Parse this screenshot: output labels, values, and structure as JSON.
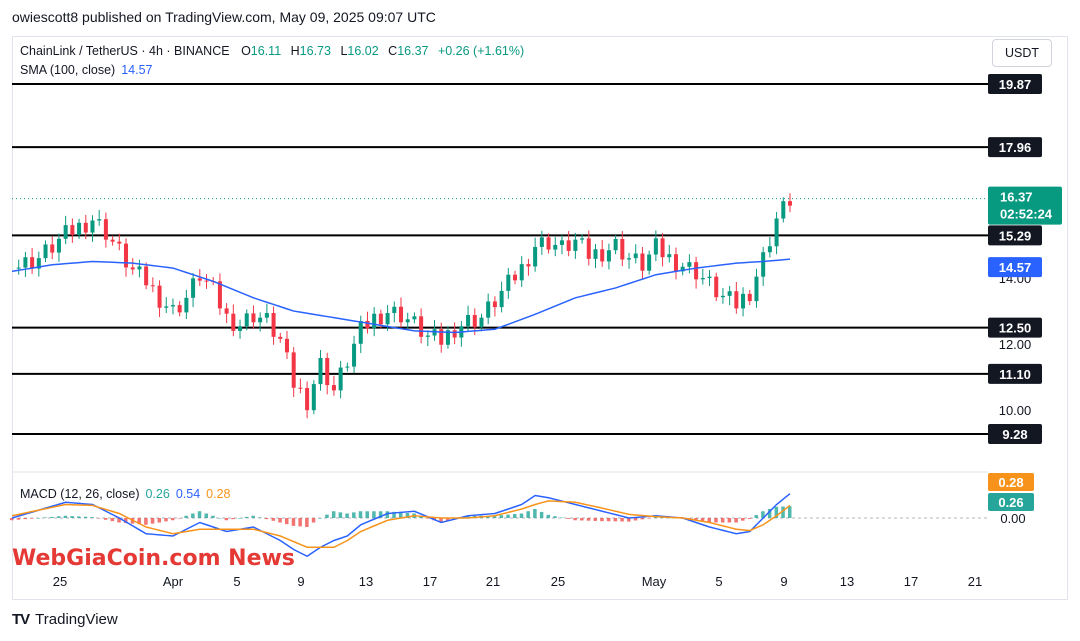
{
  "publisher_line": "owiescott8 published on TradingView.com, May 09, 2025 09:07 UTC",
  "header": {
    "symbol": "ChainLink / TetherUS · 4h · BINANCE",
    "open_key": "O",
    "open": "16.11",
    "high_key": "H",
    "high": "16.73",
    "low_key": "L",
    "low": "16.02",
    "close_key": "C",
    "close": "16.37",
    "change": "+0.26 (+1.61%)"
  },
  "sma": {
    "label": "SMA (100, close)",
    "value": "14.57"
  },
  "macd": {
    "label": "MACD (12, 26, close)",
    "hist": "0.26",
    "macd": "0.54",
    "signal": "0.28"
  },
  "currency_button": "USDT",
  "watermark": "WebGiaCoin.com News",
  "footer_brand": "TradingView",
  "footer_logo": "TV",
  "colors": {
    "up": "#089981",
    "down": "#f23645",
    "sma": "#2962ff",
    "signal": "#f7931a",
    "level": "#000000"
  },
  "chart_data": {
    "type": "candlestick",
    "symbol": "LINK/USDT",
    "interval": "4h",
    "x_ticks": [
      "25",
      "Apr",
      "5",
      "9",
      "13",
      "17",
      "21",
      "25",
      "May",
      "5",
      "9",
      "13",
      "17",
      "21"
    ],
    "y_ticks": [
      "14.00",
      "12.00",
      "10.00"
    ],
    "price_range": [
      8.6,
      20.2
    ],
    "levels": [
      19.87,
      17.96,
      15.29,
      12.5,
      11.1,
      9.28
    ],
    "level_labels": [
      "19.87",
      "17.96",
      "15.29",
      "12.50",
      "11.10",
      "9.28"
    ],
    "last_price": "16.37",
    "countdown": "02:52:24",
    "sma_value_label": "14.57",
    "price_path": [
      [
        0,
        14.3
      ],
      [
        4,
        14.6
      ],
      [
        8,
        15.3
      ],
      [
        12,
        15.8
      ],
      [
        14,
        15.4
      ],
      [
        16,
        14.8
      ],
      [
        18,
        14.2
      ],
      [
        20,
        13.9
      ],
      [
        22,
        13.4
      ],
      [
        24,
        13.0
      ],
      [
        26,
        13.4
      ],
      [
        28,
        14.1
      ],
      [
        30,
        13.6
      ],
      [
        32,
        12.8
      ],
      [
        34,
        12.6
      ],
      [
        36,
        12.9
      ],
      [
        38,
        12.7
      ],
      [
        40,
        12.1
      ],
      [
        42,
        10.8
      ],
      [
        44,
        10.3
      ],
      [
        46,
        11.4
      ],
      [
        48,
        10.6
      ],
      [
        50,
        11.5
      ],
      [
        52,
        12.4
      ],
      [
        54,
        12.8
      ],
      [
        56,
        13.0
      ],
      [
        58,
        12.9
      ],
      [
        60,
        12.6
      ],
      [
        62,
        12.2
      ],
      [
        64,
        12.1
      ],
      [
        66,
        12.5
      ],
      [
        68,
        12.7
      ],
      [
        70,
        12.8
      ],
      [
        72,
        13.3
      ],
      [
        74,
        13.8
      ],
      [
        76,
        14.3
      ],
      [
        78,
        15.0
      ],
      [
        80,
        15.1
      ],
      [
        82,
        14.9
      ],
      [
        84,
        15.1
      ],
      [
        86,
        14.7
      ],
      [
        88,
        14.8
      ],
      [
        90,
        15.0
      ],
      [
        92,
        14.6
      ],
      [
        94,
        14.4
      ],
      [
        96,
        14.9
      ],
      [
        98,
        14.6
      ],
      [
        100,
        14.4
      ],
      [
        102,
        14.2
      ],
      [
        104,
        13.8
      ],
      [
        106,
        13.4
      ],
      [
        108,
        13.2
      ],
      [
        110,
        13.6
      ],
      [
        112,
        14.6
      ],
      [
        114,
        15.8
      ],
      [
        116,
        16.37
      ]
    ],
    "sma_path": [
      [
        0,
        14.2
      ],
      [
        6,
        14.4
      ],
      [
        12,
        14.5
      ],
      [
        18,
        14.45
      ],
      [
        24,
        14.3
      ],
      [
        30,
        13.9
      ],
      [
        36,
        13.4
      ],
      [
        42,
        13.0
      ],
      [
        48,
        12.8
      ],
      [
        54,
        12.6
      ],
      [
        60,
        12.4
      ],
      [
        66,
        12.35
      ],
      [
        72,
        12.45
      ],
      [
        78,
        12.9
      ],
      [
        84,
        13.4
      ],
      [
        90,
        13.7
      ],
      [
        96,
        14.1
      ],
      [
        102,
        14.3
      ],
      [
        108,
        14.45
      ],
      [
        112,
        14.5
      ],
      [
        116,
        14.57
      ]
    ],
    "total_bars": 116,
    "macd_range": [
      -0.9,
      0.75
    ],
    "macd_zero_label": "0.00",
    "macd_signal_label": "0.28",
    "macd_hist_label": "0.26",
    "macd_line": [
      [
        0,
        0.0
      ],
      [
        8,
        0.35
      ],
      [
        12,
        0.3
      ],
      [
        16,
        0.0
      ],
      [
        20,
        -0.35
      ],
      [
        24,
        -0.4
      ],
      [
        28,
        -0.1
      ],
      [
        32,
        -0.3
      ],
      [
        36,
        -0.2
      ],
      [
        40,
        -0.5
      ],
      [
        42,
        -0.7
      ],
      [
        44,
        -0.85
      ],
      [
        46,
        -0.65
      ],
      [
        48,
        -0.5
      ],
      [
        50,
        -0.4
      ],
      [
        52,
        -0.15
      ],
      [
        56,
        0.1
      ],
      [
        60,
        0.15
      ],
      [
        64,
        -0.1
      ],
      [
        68,
        0.05
      ],
      [
        72,
        0.1
      ],
      [
        76,
        0.3
      ],
      [
        78,
        0.5
      ],
      [
        80,
        0.45
      ],
      [
        84,
        0.3
      ],
      [
        88,
        0.15
      ],
      [
        92,
        0.0
      ],
      [
        96,
        0.05
      ],
      [
        100,
        0.0
      ],
      [
        104,
        -0.2
      ],
      [
        108,
        -0.35
      ],
      [
        110,
        -0.3
      ],
      [
        112,
        0.0
      ],
      [
        114,
        0.3
      ],
      [
        116,
        0.54
      ]
    ],
    "macd_signal": [
      [
        0,
        0.05
      ],
      [
        8,
        0.3
      ],
      [
        12,
        0.28
      ],
      [
        16,
        0.1
      ],
      [
        20,
        -0.2
      ],
      [
        24,
        -0.35
      ],
      [
        28,
        -0.25
      ],
      [
        32,
        -0.25
      ],
      [
        36,
        -0.25
      ],
      [
        40,
        -0.4
      ],
      [
        44,
        -0.65
      ],
      [
        48,
        -0.65
      ],
      [
        50,
        -0.5
      ],
      [
        52,
        -0.3
      ],
      [
        56,
        -0.05
      ],
      [
        60,
        0.05
      ],
      [
        64,
        0.0
      ],
      [
        68,
        0.0
      ],
      [
        72,
        0.05
      ],
      [
        76,
        0.2
      ],
      [
        78,
        0.3
      ],
      [
        80,
        0.38
      ],
      [
        84,
        0.35
      ],
      [
        88,
        0.22
      ],
      [
        92,
        0.08
      ],
      [
        96,
        0.03
      ],
      [
        100,
        0.0
      ],
      [
        104,
        -0.1
      ],
      [
        108,
        -0.25
      ],
      [
        110,
        -0.28
      ],
      [
        112,
        -0.15
      ],
      [
        114,
        0.05
      ],
      [
        116,
        0.28
      ]
    ]
  }
}
